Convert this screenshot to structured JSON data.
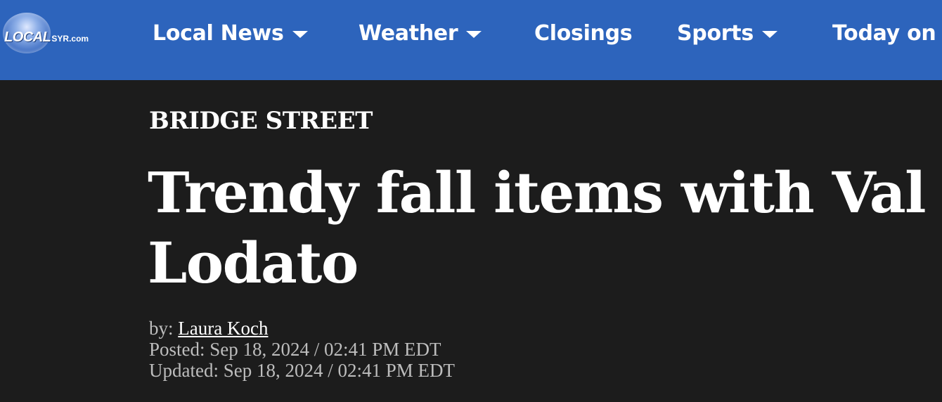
{
  "header": {
    "logo": {
      "main_text": "LOCAL",
      "suffix_text": "SYR.com"
    },
    "nav": [
      {
        "label": "Local News",
        "has_dropdown": true
      },
      {
        "label": "Weather",
        "has_dropdown": true
      },
      {
        "label": "Closings",
        "has_dropdown": false
      },
      {
        "label": "Sports",
        "has_dropdown": true
      },
      {
        "label": "Today on CNY",
        "has_dropdown": false
      }
    ]
  },
  "article": {
    "category": "BRIDGE STREET",
    "title": "Trendy fall items with Val Lodato",
    "byline_prefix": "by:",
    "author": "Laura Koch",
    "posted": "Posted: Sep 18, 2024 / 02:41 PM EDT",
    "updated": "Updated: Sep 18, 2024 / 02:41 PM EDT"
  },
  "colors": {
    "nav_background": "#2d64bc",
    "page_background": "#1c1c1c",
    "text_primary": "#ffffff",
    "text_secondary": "#bdbdbd"
  },
  "icons": {
    "dropdown": "chevron-down-icon",
    "logo": "globe-logo"
  }
}
